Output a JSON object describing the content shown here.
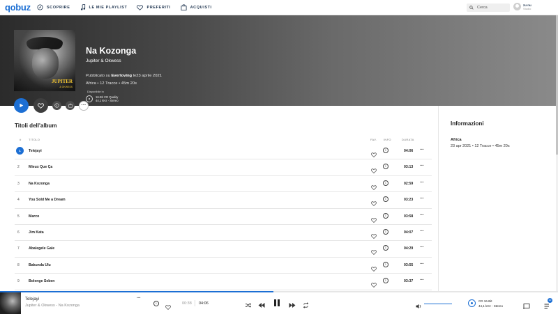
{
  "app": {
    "logo": "qobuz"
  },
  "nav": {
    "items": [
      {
        "label": "SCOPRIRE",
        "icon": "compass-icon"
      },
      {
        "label": "LE MIE PLAYLIST",
        "icon": "music-note-icon"
      },
      {
        "label": "PREFERITI",
        "icon": "heart-icon"
      },
      {
        "label": "ACQUISTI",
        "icon": "shopping-bag-icon"
      }
    ],
    "search_placeholder": "Cerca",
    "user": {
      "name": "zu nu",
      "plan": "Studio"
    }
  },
  "album": {
    "title": "Na Kozonga",
    "artist": "Jupiter & Okwess",
    "published_prefix": "Pubblicato su",
    "label": "Everloving",
    "published_suffix": "le23 aprile 2021",
    "meta": "Africa • 12 Tracce • 45m 20s",
    "available_in": "Disponibile in",
    "quality_line1": "16-Bit CD Quality",
    "quality_line2": "44,1 kHz - Stereo",
    "cover_text": "JUPITER",
    "cover_subtext": "& OKWESS"
  },
  "tracks_section": {
    "heading": "Titoli dell'album",
    "columns": {
      "num": "#",
      "title": "TITOLO",
      "fav": "FAV.",
      "info": "INFO",
      "duration": "DURATA"
    }
  },
  "tracks": [
    {
      "num": "1",
      "title": "Telejayi",
      "duration": "04:06",
      "active": true
    },
    {
      "num": "2",
      "title": "Mieux Que Ça",
      "duration": "03:13"
    },
    {
      "num": "3",
      "title": "Na Kozonga",
      "duration": "02:59"
    },
    {
      "num": "4",
      "title": "You Sold Me a Dream",
      "duration": "03:23"
    },
    {
      "num": "5",
      "title": "Marco",
      "duration": "03:58"
    },
    {
      "num": "6",
      "title": "Jim Kata",
      "duration": "04:07"
    },
    {
      "num": "7",
      "title": "Abalegele Gale",
      "duration": "04:29"
    },
    {
      "num": "8",
      "title": "Bakunda Ulu",
      "duration": "03:55"
    },
    {
      "num": "9",
      "title": "Bolenge Seben",
      "duration": "03:37"
    }
  ],
  "sidebar": {
    "heading": "Informazioni",
    "genre": "Africa",
    "details": "23 apr 2021 • 12 Tracce • 45m 20s"
  },
  "player": {
    "track_title": "Telejayi",
    "track_subtitle": "Jupiter & Okwess - Na Kozonga",
    "elapsed": "00:38",
    "total": "04:06",
    "progress_fraction": 0.49,
    "quality_line1": "CD 16-Bit",
    "quality_line2": "44,1 kHz - Stereo",
    "queue_count": "12"
  },
  "colors": {
    "accent": "#1c6fd4"
  }
}
